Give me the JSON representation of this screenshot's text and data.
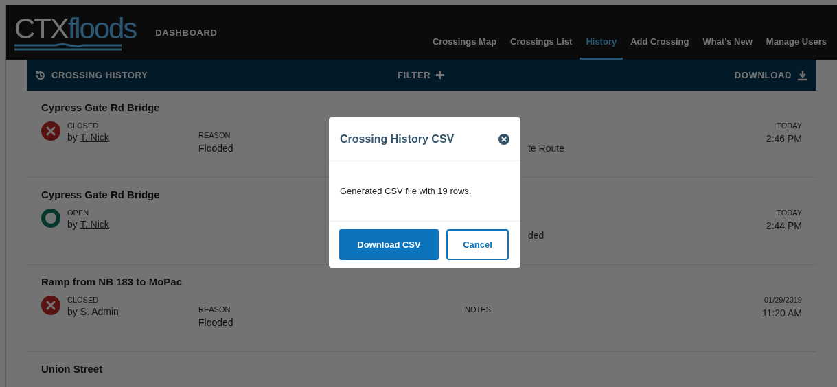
{
  "header": {
    "logo_left": "CTX",
    "logo_right": "floods",
    "subtitle": "DASHBOARD",
    "nav": [
      {
        "label": "Crossings Map",
        "selected": false
      },
      {
        "label": "Crossings List",
        "selected": false
      },
      {
        "label": "History",
        "selected": true
      },
      {
        "label": "Add Crossing",
        "selected": false
      },
      {
        "label": "What's New",
        "selected": false
      },
      {
        "label": "Manage Users",
        "selected": false
      }
    ]
  },
  "toolbar": {
    "title": "CROSSING HISTORY",
    "filter": "FILTER",
    "download": "DOWNLOAD"
  },
  "rows": [
    {
      "name": "Cypress Gate Rd Bridge",
      "status": "CLOSED",
      "kind": "closed",
      "by": "by",
      "user": "T. Nick",
      "reason_label": "REASON",
      "reason": "Flooded",
      "notes": "te Route",
      "date": "TODAY",
      "time": "2:46 PM"
    },
    {
      "name": "Cypress Gate Rd Bridge",
      "status": "OPEN",
      "kind": "open",
      "by": "by",
      "user": "T. Nick",
      "notes": "ded",
      "date": "TODAY",
      "time": "2:44 PM"
    },
    {
      "name": "Ramp from NB 183 to MoPac",
      "status": "CLOSED",
      "kind": "closed",
      "by": "by",
      "user": "S. Admin",
      "reason_label": "REASON",
      "reason": "Flooded",
      "notes_label": "NOTES",
      "date": "01/29/2019",
      "time": "11:20 AM"
    },
    {
      "name": "Union Street"
    }
  ],
  "modal": {
    "title": "Crossing History CSV",
    "message": "Generated CSV file with 19 rows.",
    "primary": "Download CSV",
    "secondary": "Cancel"
  }
}
